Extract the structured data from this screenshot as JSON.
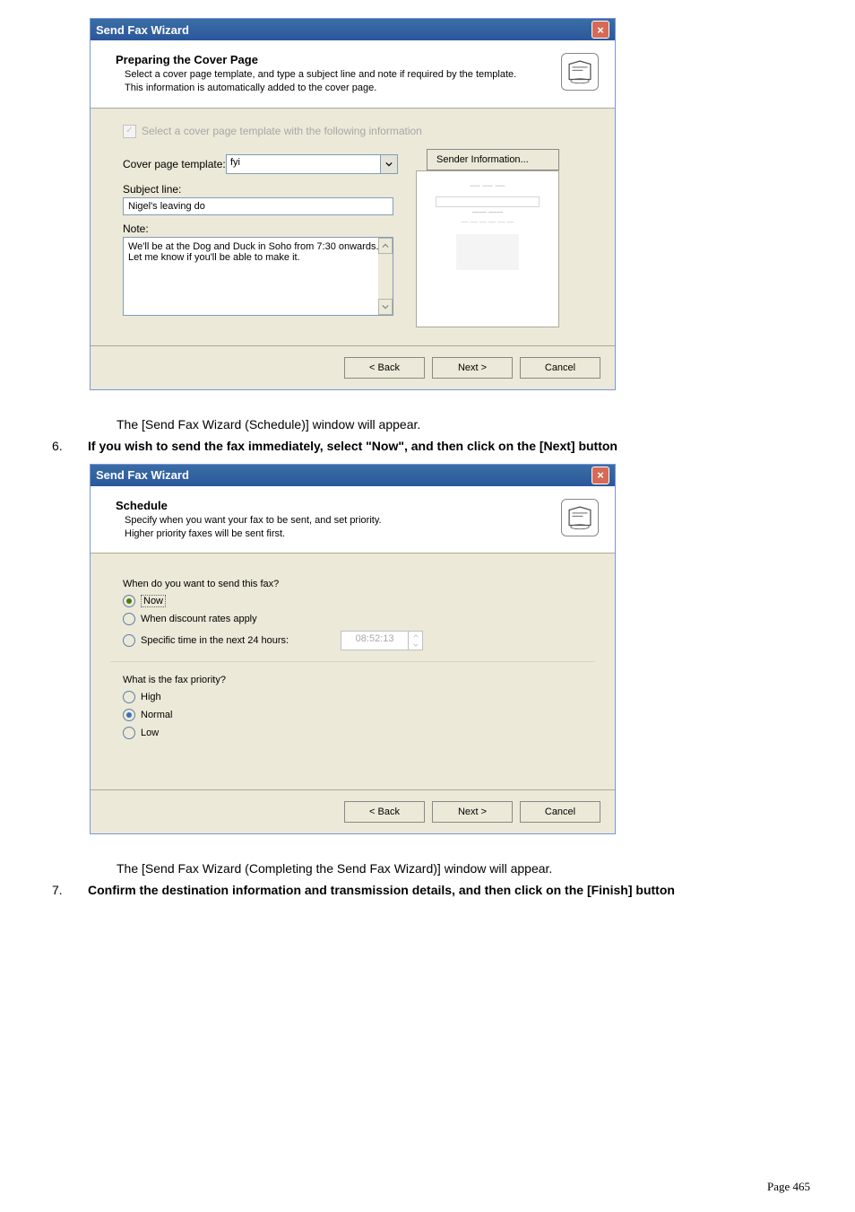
{
  "dialog1": {
    "title": "Send Fax Wizard",
    "banner_title": "Preparing the Cover Page",
    "banner_desc1": "Select a cover page template, and type a subject line and note if required by the template.",
    "banner_desc2": "This information is automatically added to the cover page.",
    "checkbox_label": "Select a cover page template with the following information",
    "template_label": "Cover page template:",
    "template_value": "fyi",
    "sender_btn": "Sender Information...",
    "subject_label": "Subject line:",
    "subject_value": "Nigel's leaving do",
    "note_label": "Note:",
    "note_value": "We'll be at the Dog and Duck in Soho from 7:30 onwards. Let me know if you'll be able to make it.",
    "back": "< Back",
    "next": "Next >",
    "cancel": "Cancel"
  },
  "para1": "The [Send Fax Wizard (Schedule)] window will appear.",
  "step6_num": "6.",
  "step6": "If you wish to send the fax immediately, select \"Now\", and then click on the [Next] button",
  "dialog2": {
    "title": "Send Fax Wizard",
    "banner_title": "Schedule",
    "banner_desc1": "Specify when you want your fax to be sent, and set priority.",
    "banner_desc2": "Higher priority faxes will be sent first.",
    "q1": "When do you want to send this fax?",
    "o_now": "Now",
    "o_discount": "When discount rates apply",
    "o_specific": "Specific time in the next 24 hours:",
    "time": "08:52:13",
    "q2": "What is the fax priority?",
    "p_high": "High",
    "p_normal": "Normal",
    "p_low": "Low",
    "back": "< Back",
    "next": "Next >",
    "cancel": "Cancel"
  },
  "para2": "The [Send Fax Wizard (Completing the Send Fax Wizard)] window will appear.",
  "step7_num": "7.",
  "step7": "Confirm the destination information and transmission details, and then click on the [Finish] button",
  "page_num": "Page 465"
}
